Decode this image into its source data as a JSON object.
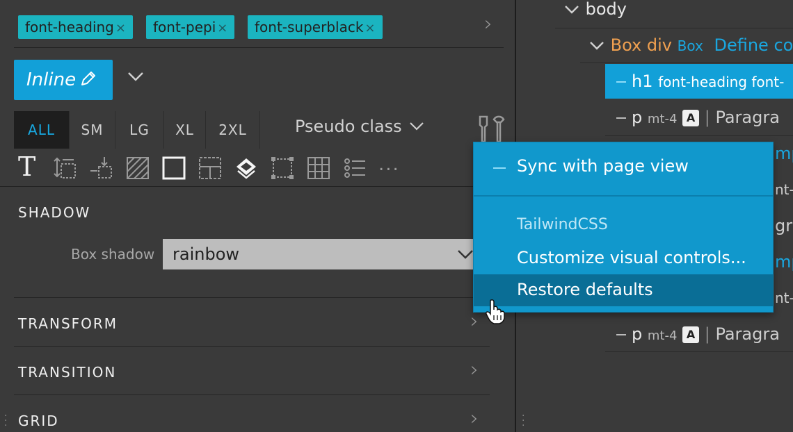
{
  "tags": [
    {
      "label": "font-heading",
      "remove": "×"
    },
    {
      "label": "font-pepi",
      "remove": "×"
    },
    {
      "label": "font-superblack",
      "remove": "×"
    }
  ],
  "mode_button": {
    "label": "Inline"
  },
  "breakpoints": [
    "ALL",
    "SM",
    "LG",
    "XL",
    "2XL"
  ],
  "active_breakpoint": "ALL",
  "pseudo_class": {
    "label": "Pseudo class"
  },
  "toolbar": {
    "more": "..."
  },
  "sections": {
    "shadow": {
      "title": "SHADOW",
      "box_shadow_label": "Box shadow",
      "box_shadow_value": "rainbow"
    },
    "transform": {
      "title": "TRANSFORM"
    },
    "transition": {
      "title": "TRANSITION"
    },
    "grid": {
      "title": "GRID"
    }
  },
  "tree": {
    "body": "body",
    "box_row": {
      "tag": "Box div",
      "component": "Box",
      "define": "Define co"
    },
    "h1_row": {
      "tag": "h1",
      "classes": "font-heading font-"
    },
    "p_rows": [
      {
        "tag": "p",
        "class": "mt-4",
        "badge": "A",
        "text": "Paragra"
      },
      {
        "tag": "p",
        "class": "mt-4",
        "badge": "A",
        "text": "Paragra"
      }
    ],
    "partial": [
      "mp",
      "nt-",
      "gra",
      "mp",
      "nt-"
    ]
  },
  "menu": {
    "sync": "Sync with page view",
    "group": "TailwindCSS",
    "customize": "Customize visual controls...",
    "restore": "Restore defaults"
  },
  "colors": {
    "accent": "#12a0d8",
    "tag": "#1bb4c0",
    "menu_bg": "#1198cc",
    "menu_hover": "#0a6e96",
    "box_orange": "#f0a050"
  }
}
